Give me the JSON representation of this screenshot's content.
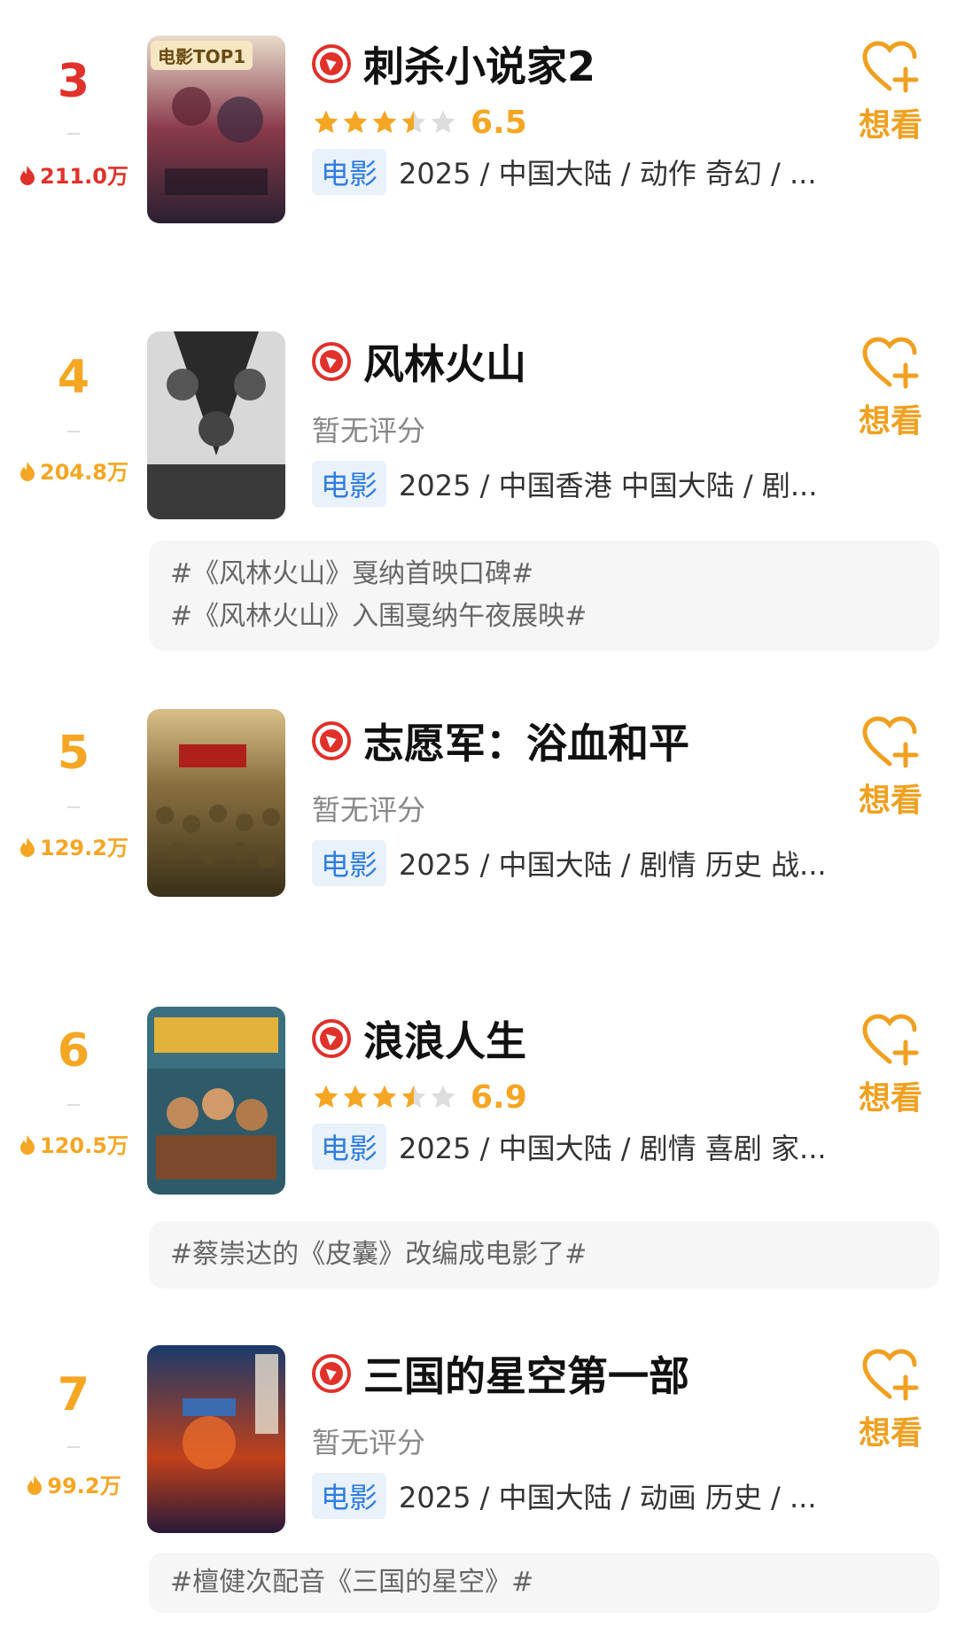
{
  "items": [
    {
      "rank": "3",
      "heat": "211.0万",
      "title": "刺杀小说家2",
      "rating": {
        "stars": 3.5,
        "score": "6.5"
      },
      "no_rating": "",
      "badge": "电影",
      "meta": "2025 / 中国大陆 / 动作 奇幻 / ...",
      "want": "想看",
      "poster_tag": "电影TOP1",
      "poster_colors": [
        "#6b2a3a",
        "#d9c4b0",
        "#2b2b3a"
      ],
      "topics": []
    },
    {
      "rank": "4",
      "heat": "204.8万",
      "title": "风林火山",
      "rating": null,
      "no_rating": "暂无评分",
      "badge": "电影",
      "meta": "2025 / 中国香港 中国大陆 / 剧...",
      "want": "想看",
      "poster_tag": "",
      "poster_colors": [
        "#2a2a2a",
        "#bfbfbf",
        "#555555"
      ],
      "topics": [
        "#《风林火山》戛纳首映口碑#",
        "#《风林火山》入围戛纳午夜展映#"
      ]
    },
    {
      "rank": "5",
      "heat": "129.2万",
      "title": "志愿军：浴血和平",
      "rating": null,
      "no_rating": "暂无评分",
      "badge": "电影",
      "meta": "2025 / 中国大陆 / 剧情 历史 战...",
      "want": "想看",
      "poster_tag": "",
      "poster_colors": [
        "#8a6b2a",
        "#c9a85a",
        "#4a3a1a"
      ],
      "topics": []
    },
    {
      "rank": "6",
      "heat": "120.5万",
      "title": "浪浪人生",
      "rating": {
        "stars": 3.5,
        "score": "6.9"
      },
      "no_rating": "",
      "badge": "电影",
      "meta": "2025 / 中国大陆 / 剧情 喜剧 家...",
      "want": "想看",
      "poster_tag": "",
      "poster_colors": [
        "#2e5a6a",
        "#e2b23a",
        "#7a4a2a"
      ],
      "topics": [
        "#蔡崇达的《皮囊》改编成电影了#"
      ]
    },
    {
      "rank": "7",
      "heat": "99.2万",
      "title": "三国的星空第一部",
      "rating": null,
      "no_rating": "暂无评分",
      "badge": "电影",
      "meta": "2025 / 中国大陆 / 动画 历史 / ...",
      "want": "想看",
      "poster_tag": "",
      "poster_colors": [
        "#1a3a6a",
        "#d84a1a",
        "#3a6ab0"
      ],
      "topics": [
        "#檀健次配音《三国的星空》#"
      ]
    }
  ],
  "colors": {
    "rank_top": "#e0312a",
    "rank": "#f5a623",
    "flame_top": "#e0312a",
    "flame": "#f5a623",
    "star": "#f5a623",
    "star_empty": "#dddddd"
  }
}
